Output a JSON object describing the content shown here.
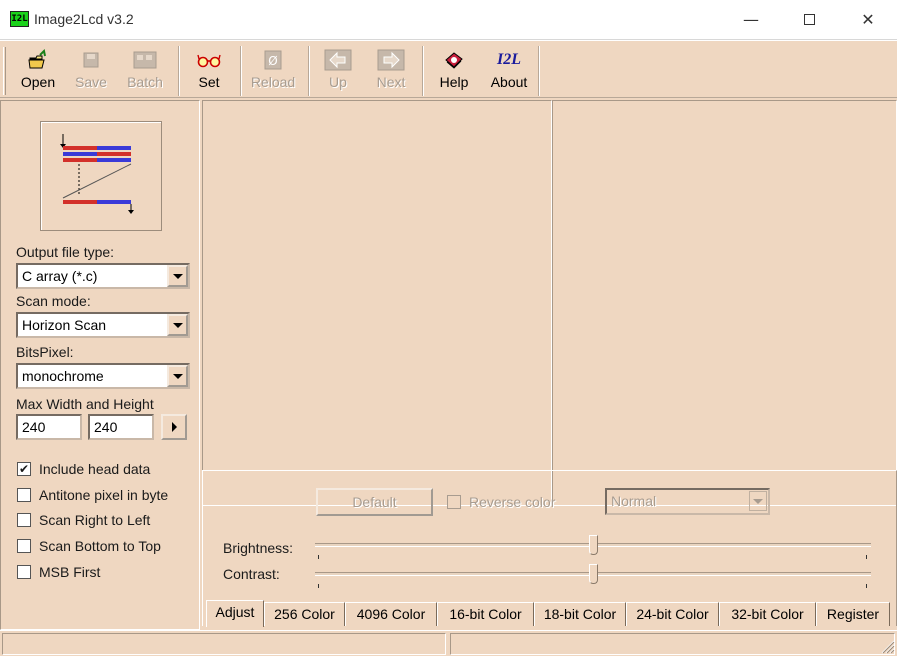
{
  "window": {
    "icon_text": "I2L",
    "title": "Image2Lcd v3.2",
    "minimize": "—",
    "close": "✕"
  },
  "toolbar": {
    "open": "Open",
    "save": "Save",
    "batch": "Batch",
    "set": "Set",
    "reload": "Reload",
    "up": "Up",
    "next": "Next",
    "help": "Help",
    "about": "About",
    "about_icon_text": "I2L"
  },
  "left": {
    "output_file_type_label": "Output file type:",
    "output_file_type_value": "C array (*.c)",
    "scan_mode_label": "Scan mode:",
    "scan_mode_value": "Horizon Scan",
    "bits_pixel_label": "BitsPixel:",
    "bits_pixel_value": "monochrome",
    "max_wh_label": "Max Width and Height",
    "max_width": "240",
    "max_height": "240",
    "checkboxes": [
      {
        "label": "Include head data",
        "checked": true
      },
      {
        "label": "Antitone pixel in byte",
        "checked": false
      },
      {
        "label": "Scan Right to Left",
        "checked": false
      },
      {
        "label": "Scan Bottom to Top",
        "checked": false
      },
      {
        "label": "MSB First",
        "checked": false
      }
    ]
  },
  "adjust": {
    "default_button": "Default",
    "reverse_color": "Reverse color",
    "mode_value": "Normal",
    "brightness_label": "Brightness:",
    "contrast_label": "Contrast:",
    "brightness_level": 0.5,
    "contrast_level": 0.5
  },
  "tabs": [
    "Adjust",
    "256 Color",
    "4096 Color",
    "16-bit Color",
    "18-bit Color",
    "24-bit Color",
    "32-bit Color",
    "Register"
  ],
  "active_tab": "Adjust",
  "colors": {
    "face": "#efd7c1",
    "app_icon": "#1bd21b"
  }
}
